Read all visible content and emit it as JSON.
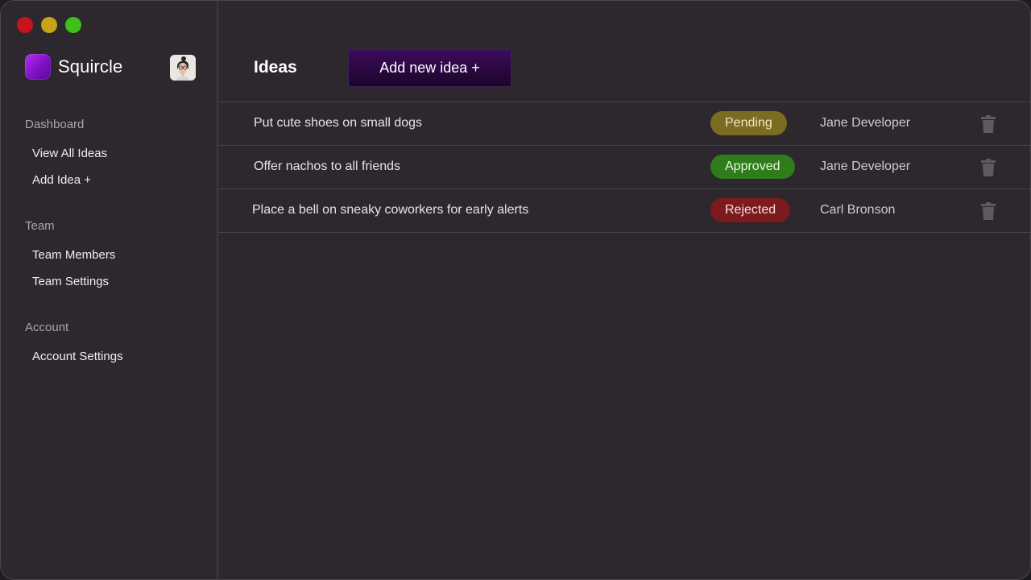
{
  "app": {
    "name": "Squircle"
  },
  "sidebar": {
    "sections": [
      {
        "heading": "Dashboard",
        "items": [
          {
            "label": "View All Ideas"
          },
          {
            "label": "Add Idea +"
          }
        ]
      },
      {
        "heading": "Team",
        "items": [
          {
            "label": "Team Members"
          },
          {
            "label": "Team Settings"
          }
        ]
      },
      {
        "heading": "Account",
        "items": [
          {
            "label": "Account Settings"
          }
        ]
      }
    ]
  },
  "main": {
    "title": "Ideas",
    "add_button_label": "Add new idea +",
    "ideas": [
      {
        "title": "Put cute shoes on small dogs",
        "status": "Pending",
        "owner": "Jane Developer"
      },
      {
        "title": "Offer nachos to all friends",
        "status": "Approved",
        "owner": "Jane Developer"
      },
      {
        "title": "Place a bell on sneaky coworkers for early alerts",
        "status": "Rejected",
        "owner": "Carl Bronson"
      }
    ]
  },
  "colors": {
    "background": "#2c282e",
    "accent": "#3b0a5e",
    "status_pending": "#7c6c22",
    "status_approved": "#2f7d1a",
    "status_rejected": "#7d1a1e"
  },
  "icons": {
    "delete": "trash-icon",
    "window_controls": [
      "close-icon",
      "minimize-icon",
      "maximize-icon"
    ]
  }
}
